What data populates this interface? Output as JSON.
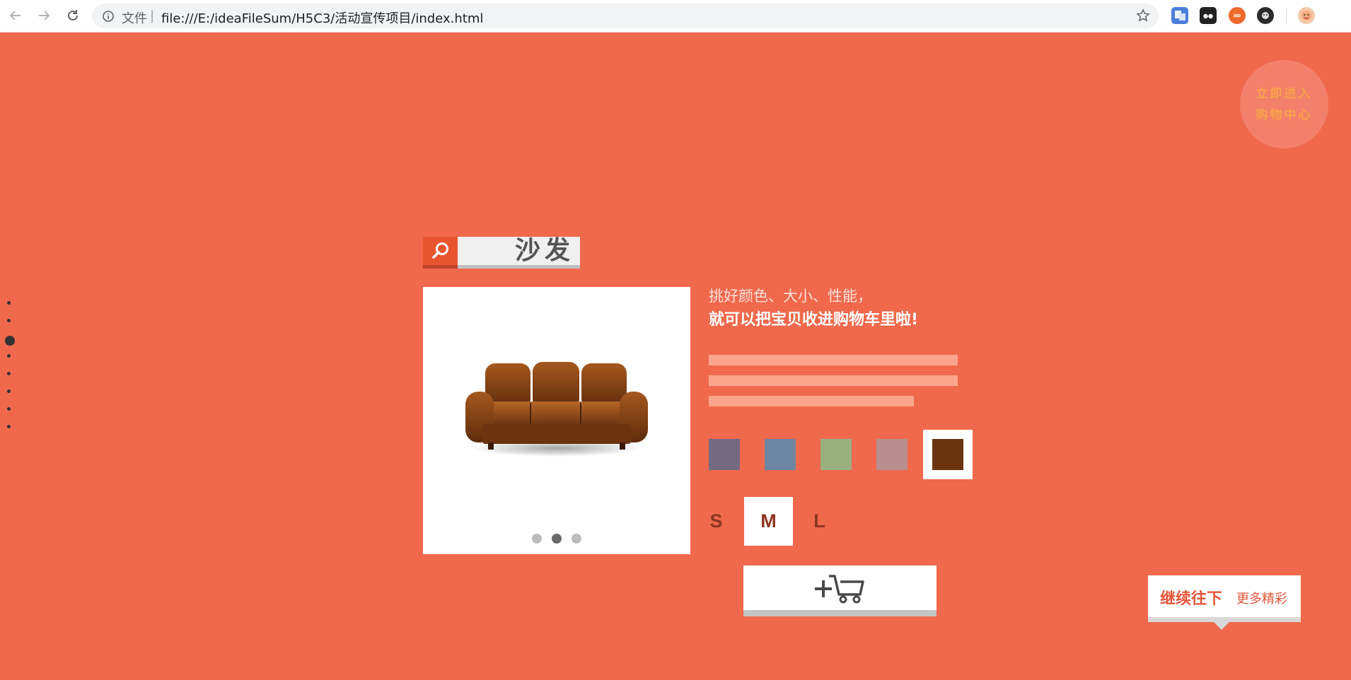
{
  "browser": {
    "file_label": "文件",
    "separator": "|",
    "url": "file:///E:/ideaFileSum/H5C3/活动宣传项目/index.html"
  },
  "corner_badge": {
    "line1": "立即进入",
    "line2": "购物中心"
  },
  "side_nav": {
    "count": 8,
    "active_index": 2
  },
  "search": {
    "keyword": "沙发"
  },
  "product": {
    "image": "sofa-image",
    "carousel": {
      "count": 3,
      "active_index": 1
    }
  },
  "tagline": {
    "line1": "挑好颜色、大小、性能，",
    "line2": "就可以把宝贝收进购物车里啦!"
  },
  "colors": {
    "options": [
      "#736a81",
      "#6e86a3",
      "#97b07e",
      "#b88e8f",
      "#6a3410"
    ],
    "selected_index": 4
  },
  "sizes": {
    "options": [
      "S",
      "M",
      "L"
    ],
    "selected_index": 1
  },
  "cart_button": {
    "icon": "add-to-cart-icon"
  },
  "continue": {
    "bold": "继续往下",
    "light": "更多精彩"
  },
  "theme": {
    "background": "#f0694c",
    "accent": "#e8552e"
  }
}
